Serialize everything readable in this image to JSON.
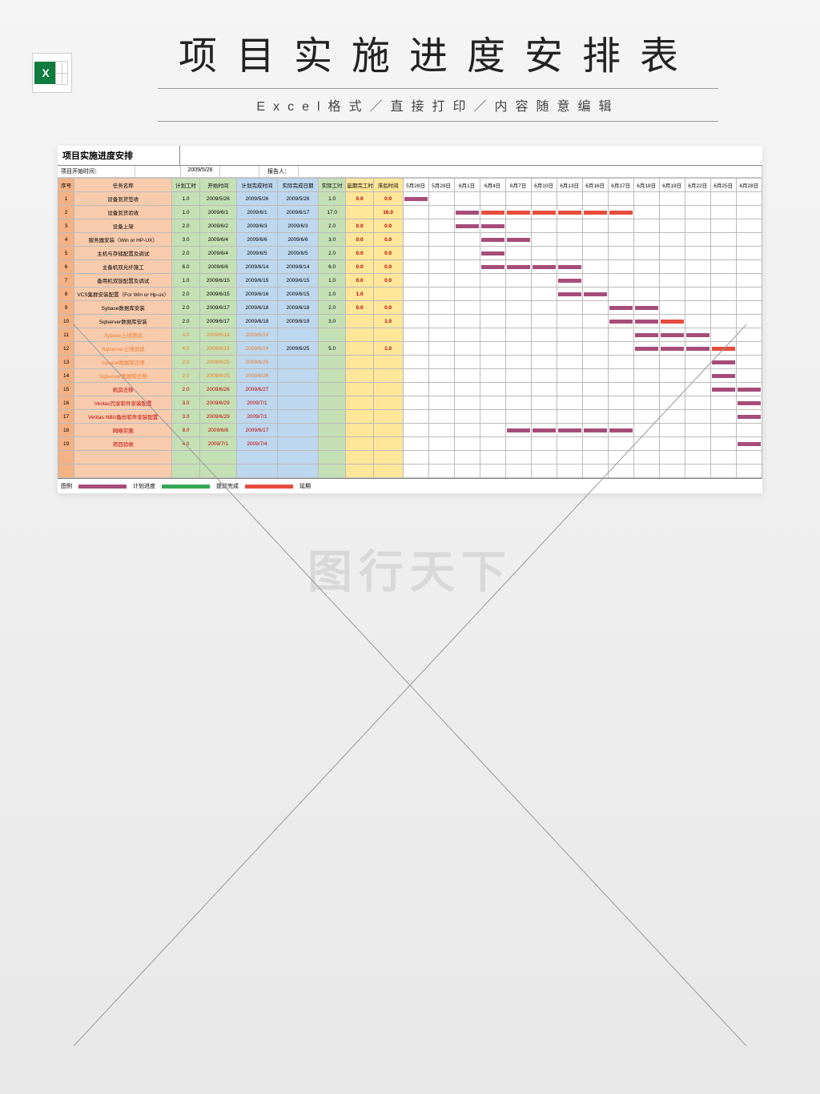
{
  "header": {
    "main_title": "项目实施进度安排表",
    "sub_title": "Excel格式／直接打印／内容随意编辑",
    "excel_badge": "X"
  },
  "sheet": {
    "title": "项目实施进度安排",
    "meta_start_label": "项目开始时间：",
    "meta_start_value": "2009/5/26",
    "meta_reporter_label": "报告人：",
    "columns": {
      "seq": "序号",
      "task": "任务名称",
      "plan_hours": "计划工时",
      "start": "开始时间",
      "plan_end": "计划完成时间",
      "actual_end": "实际完成日期",
      "actual_hours": "实际工时",
      "delay_hours": "延期完工时间",
      "delay_time": "滞后时间"
    },
    "dates": [
      "5月28日",
      "5月29日",
      "6月1日",
      "6月4日",
      "6月7日",
      "6月10日",
      "6月13日",
      "6月16日",
      "6月17日",
      "6月18日",
      "6月19日",
      "6月22日",
      "6月25日",
      "6月28日"
    ],
    "rows": [
      {
        "seq": "1",
        "task": "设备到货签收",
        "plan_hr": "1.0",
        "start": "2009/5/26",
        "plan_end": "2009/5/26",
        "actual_end": "2009/5/26",
        "act_hr": "1.0",
        "delay_hr": "0.0",
        "delay_t": "0.0",
        "style": "",
        "bar_start": 0,
        "bar_len": 1,
        "delay_len": 0
      },
      {
        "seq": "2",
        "task": "设备到货验收",
        "plan_hr": "1.0",
        "start": "2009/6/1",
        "plan_end": "2009/6/1",
        "actual_end": "2009/6/17",
        "act_hr": "17.0",
        "delay_hr": "",
        "delay_t": "16.0",
        "style": "",
        "bar_start": 2,
        "bar_len": 1,
        "delay_len": 6
      },
      {
        "seq": "3",
        "task": "设备上架",
        "plan_hr": "2.0",
        "start": "2009/6/2",
        "plan_end": "2009/6/3",
        "actual_end": "2009/6/3",
        "act_hr": "2.0",
        "delay_hr": "0.0",
        "delay_t": "0.0",
        "style": "",
        "bar_start": 2,
        "bar_len": 2,
        "delay_len": 0
      },
      {
        "seq": "4",
        "task": "服务器安装（Win or HP-UX）",
        "plan_hr": "3.0",
        "start": "2009/6/4",
        "plan_end": "2009/6/6",
        "actual_end": "2009/6/6",
        "act_hr": "3.0",
        "delay_hr": "0.0",
        "delay_t": "0.0",
        "style": "",
        "bar_start": 3,
        "bar_len": 2,
        "delay_len": 0
      },
      {
        "seq": "5",
        "task": "主机与存储配置及调试",
        "plan_hr": "2.0",
        "start": "2009/6/4",
        "plan_end": "2009/6/5",
        "actual_end": "2009/6/5",
        "act_hr": "2.0",
        "delay_hr": "0.0",
        "delay_t": "0.0",
        "style": "",
        "bar_start": 3,
        "bar_len": 1,
        "delay_len": 0
      },
      {
        "seq": "6",
        "task": "主备机双光纤施工",
        "plan_hr": "6.0",
        "start": "2009/6/6",
        "plan_end": "2009/6/14",
        "actual_end": "2009/6/14",
        "act_hr": "6.0",
        "delay_hr": "0.0",
        "delay_t": "0.0",
        "style": "",
        "bar_start": 3,
        "bar_len": 4,
        "delay_len": 0
      },
      {
        "seq": "7",
        "task": "备用机双链配置及调试",
        "plan_hr": "1.0",
        "start": "2009/6/15",
        "plan_end": "2009/6/15",
        "actual_end": "2009/6/15",
        "act_hr": "1.0",
        "delay_hr": "0.0",
        "delay_t": "0.0",
        "style": "",
        "bar_start": 6,
        "bar_len": 1,
        "delay_len": 0
      },
      {
        "seq": "8",
        "task": "VCS集群安装配置（For Win or Hp-ux）",
        "plan_hr": "2.0",
        "start": "2009/6/15",
        "plan_end": "2009/6/16",
        "actual_end": "2009/6/15",
        "act_hr": "1.0",
        "delay_hr": "1.0",
        "delay_t": "",
        "style": "",
        "bar_start": 6,
        "bar_len": 2,
        "delay_len": 0
      },
      {
        "seq": "9",
        "task": "Sybase数据库安装",
        "plan_hr": "2.0",
        "start": "2009/6/17",
        "plan_end": "2009/6/18",
        "actual_end": "2009/6/18",
        "act_hr": "2.0",
        "delay_hr": "0.0",
        "delay_t": "0.0",
        "style": "",
        "bar_start": 8,
        "bar_len": 2,
        "delay_len": 0
      },
      {
        "seq": "10",
        "task": "Sqlserver数据库安装",
        "plan_hr": "2.0",
        "start": "2009/6/17",
        "plan_end": "2009/6/18",
        "actual_end": "2009/6/19",
        "act_hr": "3.0",
        "delay_hr": "",
        "delay_t": "1.0",
        "style": "",
        "bar_start": 8,
        "bar_len": 2,
        "delay_len": 1
      },
      {
        "seq": "11",
        "task": "Sybase上线测试",
        "plan_hr": "4.0",
        "start": "2009/6/18",
        "plan_end": "2009/6/24",
        "actual_end": "",
        "act_hr": "",
        "delay_hr": "",
        "delay_t": "",
        "style": "orange",
        "bar_start": 9,
        "bar_len": 3,
        "delay_len": 0
      },
      {
        "seq": "12",
        "task": "Sqlserver上线测试",
        "plan_hr": "4.0",
        "start": "2009/6/18",
        "plan_end": "2009/6/24",
        "actual_end": "2009/6/25",
        "act_hr": "5.0",
        "delay_hr": "",
        "delay_t": "1.0",
        "style": "orange",
        "bar_start": 9,
        "bar_len": 3,
        "delay_len": 1
      },
      {
        "seq": "13",
        "task": "Sybase数据库迁移",
        "plan_hr": "2.0",
        "start": "2009/6/25",
        "plan_end": "2009/6/26",
        "actual_end": "",
        "act_hr": "",
        "delay_hr": "",
        "delay_t": "",
        "style": "orange",
        "bar_start": 12,
        "bar_len": 1,
        "delay_len": 0
      },
      {
        "seq": "14",
        "task": "Sqlserver数据库迁移",
        "plan_hr": "2.0",
        "start": "2009/6/25",
        "plan_end": "2009/6/26",
        "actual_end": "",
        "act_hr": "",
        "delay_hr": "",
        "delay_t": "",
        "style": "orange",
        "bar_start": 12,
        "bar_len": 1,
        "delay_len": 0
      },
      {
        "seq": "15",
        "task": "机房迁移",
        "plan_hr": "2.0",
        "start": "2009/6/26",
        "plan_end": "2009/6/27",
        "actual_end": "",
        "act_hr": "",
        "delay_hr": "",
        "delay_t": "",
        "style": "red",
        "bar_start": 12,
        "bar_len": 2,
        "delay_len": 0
      },
      {
        "seq": "16",
        "task": "Veritas冗余软件安装配置",
        "plan_hr": "3.0",
        "start": "2009/6/29",
        "plan_end": "2009/7/1",
        "actual_end": "",
        "act_hr": "",
        "delay_hr": "",
        "delay_t": "",
        "style": "red",
        "bar_start": 13,
        "bar_len": 1,
        "delay_len": 0
      },
      {
        "seq": "17",
        "task": "Veritas NBU备份软件安装配置",
        "plan_hr": "3.0",
        "start": "2009/6/29",
        "plan_end": "2009/7/1",
        "actual_end": "",
        "act_hr": "",
        "delay_hr": "",
        "delay_t": "",
        "style": "red",
        "bar_start": 13,
        "bar_len": 1,
        "delay_len": 0
      },
      {
        "seq": "18",
        "task": "网络实施",
        "plan_hr": "8.0",
        "start": "2009/6/8",
        "plan_end": "2009/6/17",
        "actual_end": "",
        "act_hr": "",
        "delay_hr": "",
        "delay_t": "",
        "style": "red",
        "bar_start": 4,
        "bar_len": 5,
        "delay_len": 0
      },
      {
        "seq": "19",
        "task": "项目验收",
        "plan_hr": "4.0",
        "start": "2009/7/1",
        "plan_end": "2009/7/4",
        "actual_end": "",
        "act_hr": "",
        "delay_hr": "",
        "delay_t": "",
        "style": "red",
        "bar_start": 13,
        "bar_len": 1,
        "delay_len": 0
      }
    ],
    "legend": {
      "label": "图例",
      "plan": "计划进度",
      "done": "提前完成",
      "delay": "延期"
    }
  },
  "watermark": "图行天下"
}
